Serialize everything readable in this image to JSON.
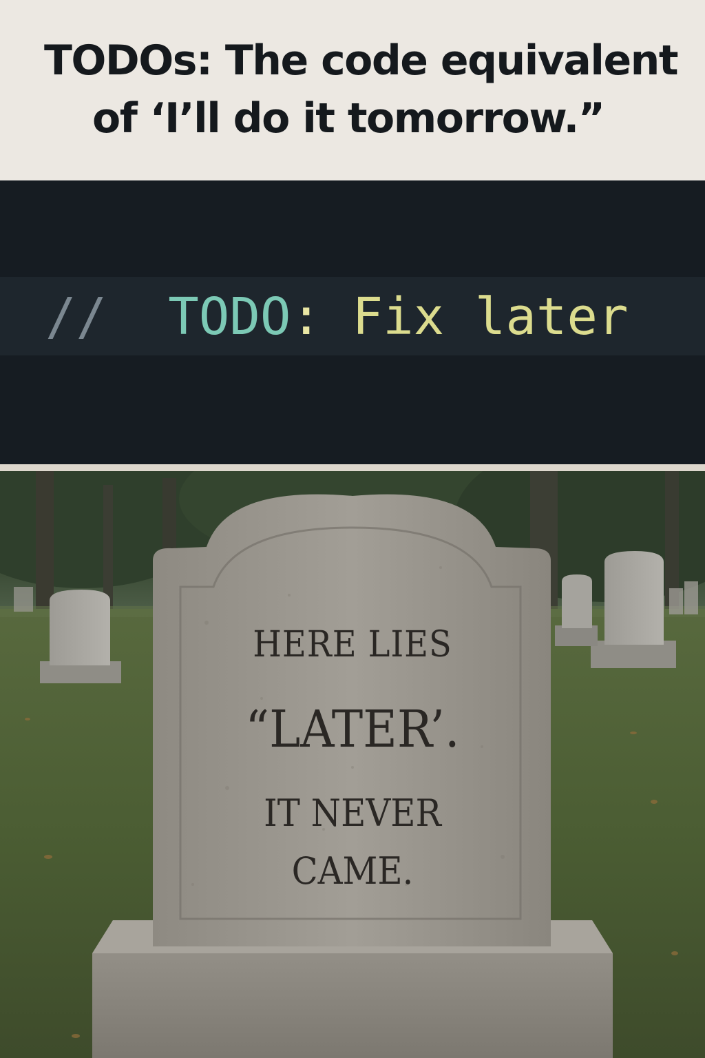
{
  "caption": {
    "line1": "TODOs: The code equivalent",
    "line2": "of ‘I’ll do it tomorrow.”"
  },
  "code": {
    "comment": "//",
    "keyword": "TODO",
    "colon": ":",
    "text": "Fix later"
  },
  "epitaph": {
    "line1": "HERE LIES",
    "line2": "“LATER’.",
    "line3": "IT NEVER",
    "line4": "CAME."
  },
  "colors": {
    "caption_bg": "#ece8e2",
    "code_bg": "#161c22",
    "code_keyword": "#7cc9b5",
    "code_text": "#dcdc8e",
    "code_comment": "#7b8790"
  }
}
